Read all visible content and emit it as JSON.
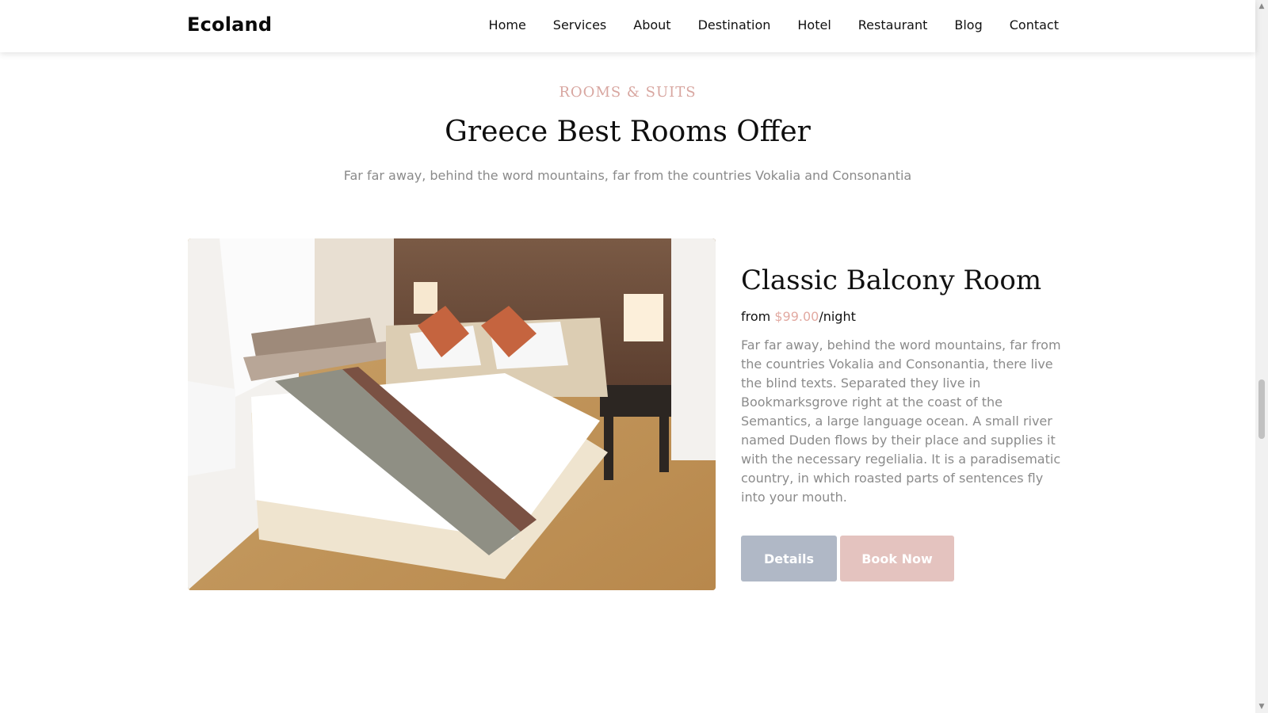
{
  "nav": {
    "brand": "Ecoland",
    "links": [
      "Home",
      "Services",
      "About",
      "Destination",
      "Hotel",
      "Restaurant",
      "Blog",
      "Contact"
    ]
  },
  "section": {
    "eyebrow": "ROOMS & SUITS",
    "heading": "Greece Best Rooms Offer",
    "subtitle": "Far far away, behind the word mountains, far from the countries Vokalia and Consonantia"
  },
  "room": {
    "title": "Classic Balcony Room",
    "price_prefix": "from ",
    "price": "$99.00",
    "price_suffix": "/night",
    "description": "Far far away, behind the word mountains, far from the countries Vokalia and Consonantia, there live the blind texts. Separated they live in Bookmarksgrove right at the coast of the Semantics, a large language ocean. A small river named Duden flows by their place and supplies it with the necessary regelialia. It is a paradisematic country, in which roasted parts of sentences fly into your mouth.",
    "details_label": "Details",
    "book_label": "Book Now"
  },
  "colors": {
    "accent": "#e2aaa2",
    "details_button": "#b0b8c6",
    "book_button": "#e4c3bf"
  },
  "icons": {
    "scroll_up": "scroll-up-arrow-icon",
    "scroll_down": "scroll-down-arrow-icon"
  }
}
